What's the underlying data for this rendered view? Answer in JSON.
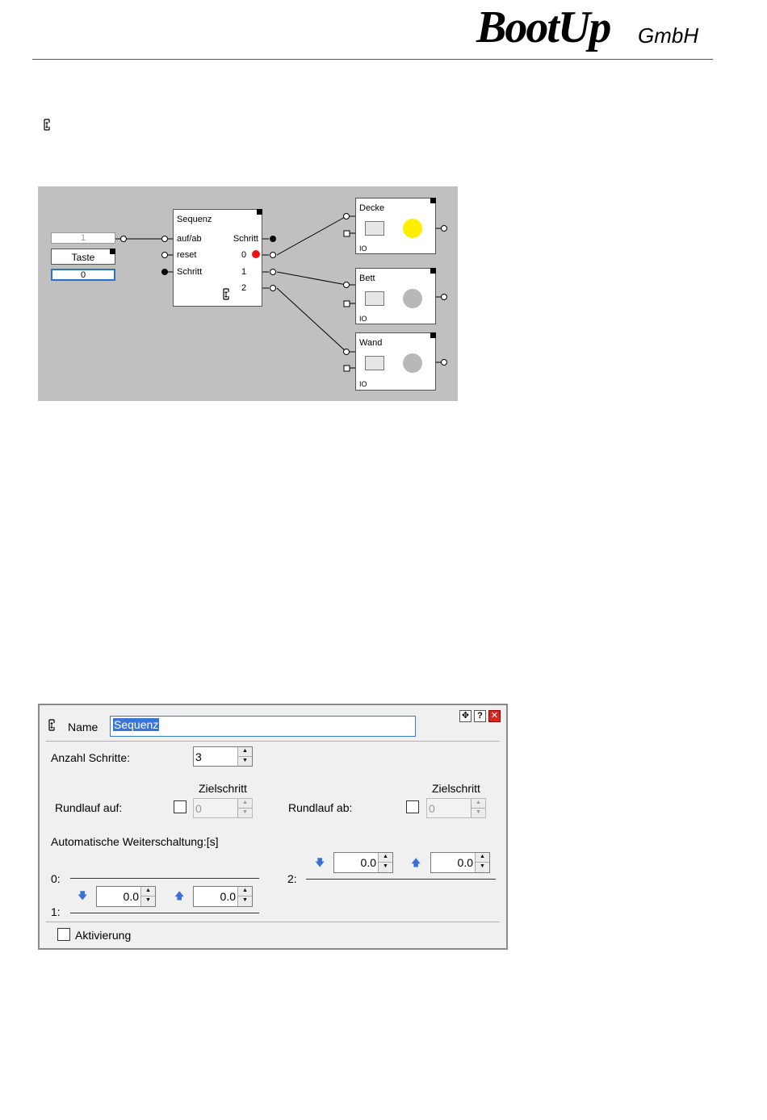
{
  "header": {
    "logo_main": "BootUp",
    "logo_sub": "GmbH"
  },
  "diagram": {
    "input": {
      "top_value": "1",
      "label": "Taste",
      "bottom_value": "0"
    },
    "sequenz": {
      "title": "Sequenz",
      "inputs": [
        "auf/ab",
        "reset",
        "Schritt"
      ],
      "outputs": [
        "Schritt",
        "0",
        "1",
        "2"
      ]
    },
    "lamps": [
      {
        "title": "Decke",
        "io": "IO",
        "color": "#ffee00"
      },
      {
        "title": "Bett",
        "io": "IO",
        "color": "#b8b8b8"
      },
      {
        "title": "Wand",
        "io": "IO",
        "color": "#b8b8b8"
      }
    ],
    "active_dot_color": "#ee1111"
  },
  "dialog": {
    "name_label": "Name",
    "name_value": "Sequenz",
    "anzahl_label": "Anzahl Schritte:",
    "anzahl_value": "3",
    "zielschritt_label": "Zielschritt",
    "rundlauf_auf_label": "Rundlauf auf:",
    "rundlauf_auf_value": "0",
    "rundlauf_ab_label": "Rundlauf ab:",
    "rundlauf_ab_value": "0",
    "auto_label": "Automatische Weiterschaltung:[s]",
    "steps": [
      {
        "label": "0:"
      },
      {
        "label": "1:",
        "down": "0.0",
        "up": "0.0"
      },
      {
        "label": "2:",
        "down": "0.0",
        "up": "0.0"
      }
    ],
    "aktivierung_label": "Aktivierung"
  }
}
